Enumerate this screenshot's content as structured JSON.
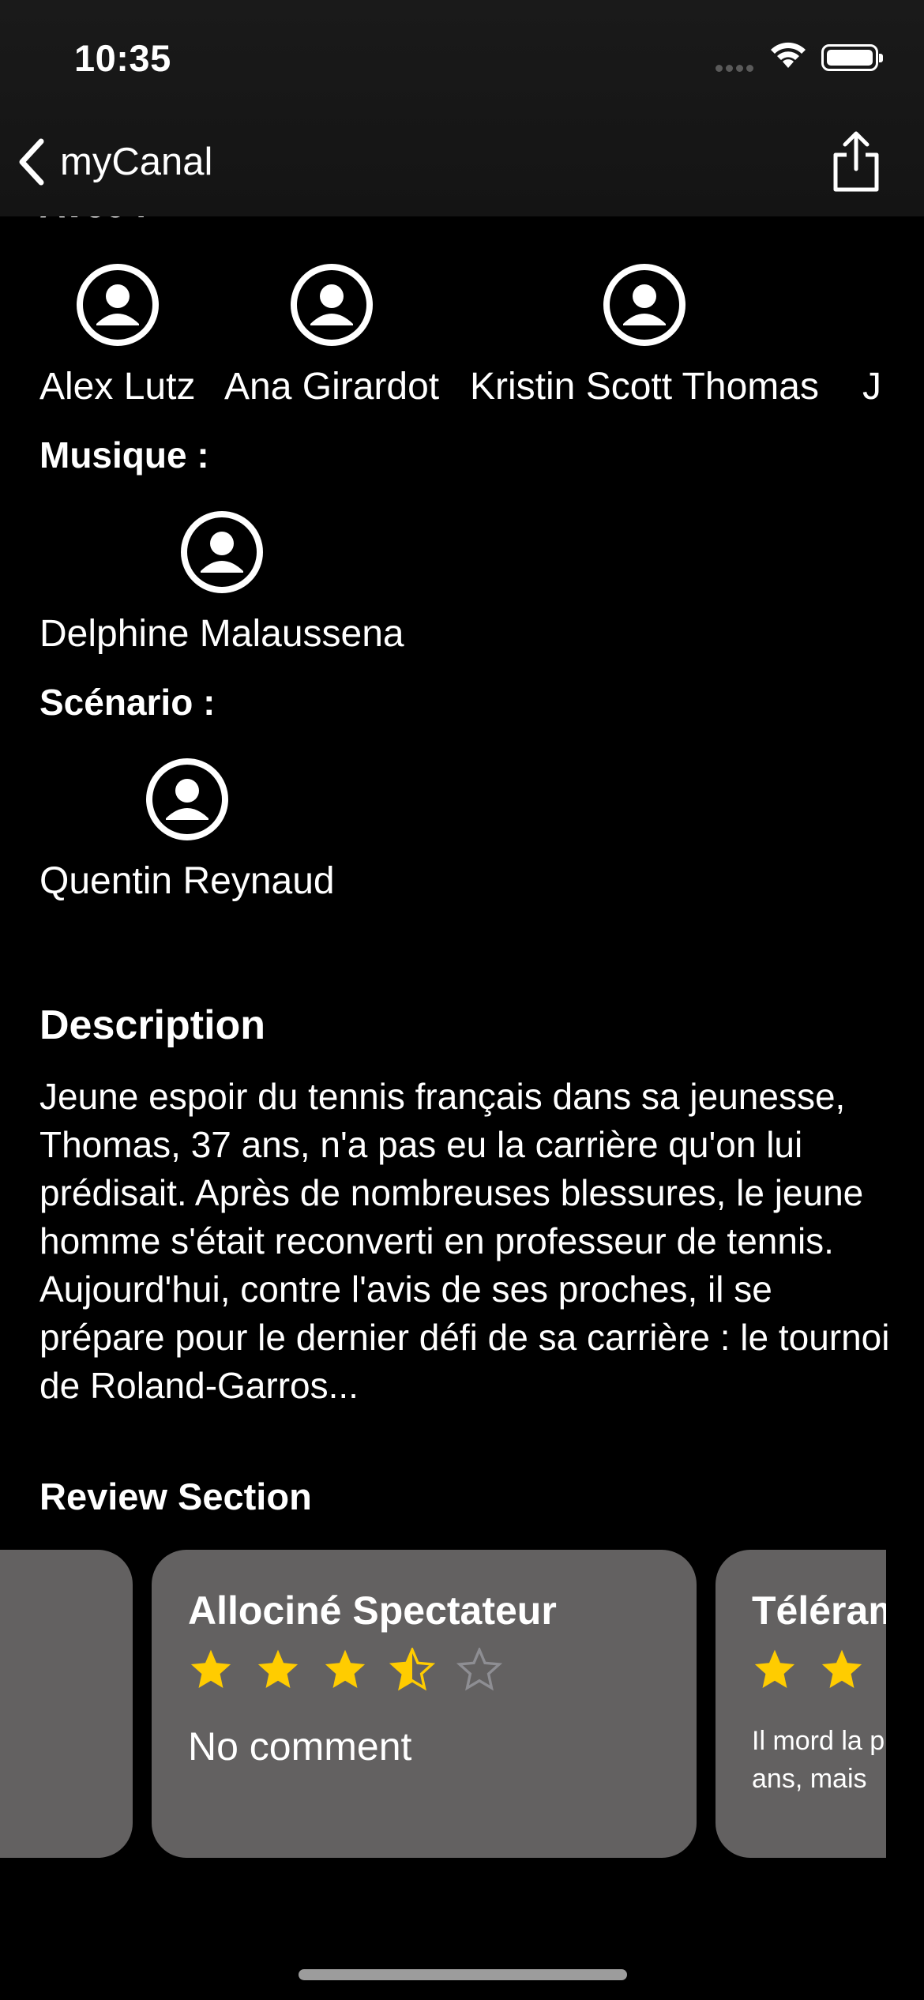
{
  "status_bar": {
    "time": "10:35"
  },
  "nav": {
    "back_label": "myCanal"
  },
  "cast": {
    "partial_heading": "Avec :",
    "people": [
      {
        "name": "Alex Lutz"
      },
      {
        "name": "Ana Girardot"
      },
      {
        "name": "Kristin Scott Thomas"
      },
      {
        "name": "J"
      }
    ]
  },
  "music": {
    "heading": "Musique :",
    "people": [
      {
        "name": "Delphine Malaussena"
      }
    ]
  },
  "screenplay": {
    "heading": "Scénario :",
    "people": [
      {
        "name": "Quentin Reynaud"
      }
    ]
  },
  "description": {
    "title": "Description",
    "text": "Jeune espoir du tennis français dans sa jeunesse, Thomas, 37 ans, n'a pas eu la carrière qu'on lui prédisait. Après de nombreuses blessures, le jeune homme s'était reconverti en professeur de tennis. Aujourd'hui, contre l'avis de ses proches, il se prépare pour le dernier défi de sa carrière : le tournoi de Roland-Garros..."
  },
  "reviews": {
    "title": "Review Section",
    "cards": [
      {
        "source": "",
        "rating": null,
        "comment": ""
      },
      {
        "source": "Allociné Spectateur",
        "rating": 3.5,
        "max_rating": 5,
        "comment": "No comment"
      },
      {
        "source": "Téléram",
        "rating": 2,
        "comment_line1": "Il mord la p",
        "comment_line2": "ans, mais"
      }
    ]
  },
  "colors": {
    "background": "#000000",
    "card": "#636161",
    "star": "#FFCC00",
    "empty_star": "#8E8E93"
  },
  "icons": [
    "back-chevron-icon",
    "share-icon",
    "person-circle-icon",
    "star-icon",
    "wifi-icon",
    "battery-icon"
  ]
}
